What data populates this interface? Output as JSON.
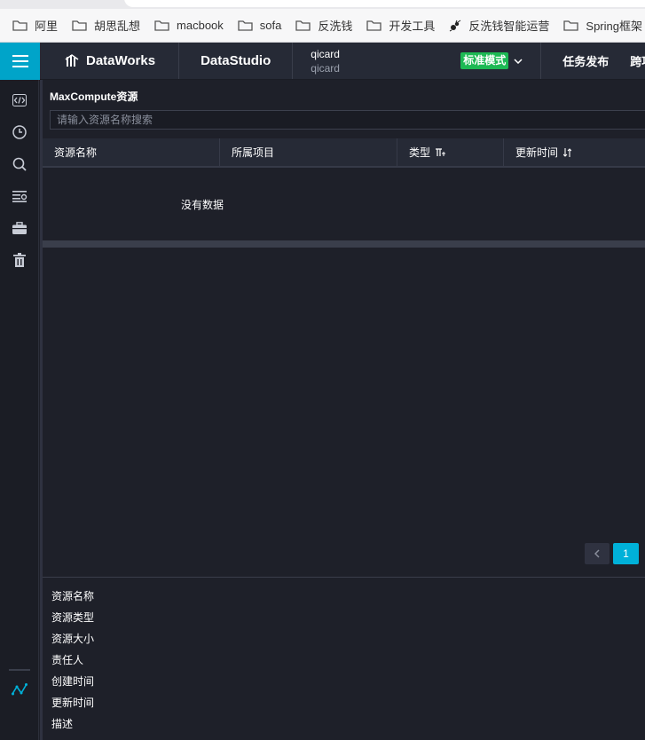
{
  "bookmarks": [
    {
      "label": "阿里",
      "icon": "folder-icon"
    },
    {
      "label": "胡思乱想",
      "icon": "folder-icon"
    },
    {
      "label": "macbook",
      "icon": "folder-icon"
    },
    {
      "label": "sofa",
      "icon": "folder-icon"
    },
    {
      "label": "反洗钱",
      "icon": "folder-icon"
    },
    {
      "label": "开发工具",
      "icon": "folder-icon"
    },
    {
      "label": "反洗钱智能运营",
      "icon": "ant-icon"
    },
    {
      "label": "Spring框架",
      "icon": "folder-icon"
    }
  ],
  "topnav": {
    "brand": "DataWorks",
    "studio": "DataStudio",
    "project_name": "qicard",
    "project_sub": "qicard",
    "mode_badge": "标准模式",
    "links": [
      "任务发布",
      "跨项目"
    ],
    "accent": "#00a4c9",
    "mode_color": "#1db954"
  },
  "sidebar": {
    "icons": [
      "code-icon",
      "history-icon",
      "search-icon",
      "list-settings-icon",
      "toolbox-icon",
      "trash-icon",
      "lineage-icon"
    ]
  },
  "main": {
    "section_title": "MaxCompute资源",
    "search_placeholder": "请输入资源名称搜索",
    "columns": [
      "资源名称",
      "所属项目",
      "类型",
      "更新时间"
    ],
    "empty_text": "没有数据",
    "page": "1",
    "details": [
      "资源名称",
      "资源类型",
      "资源大小",
      "责任人",
      "创建时间",
      "更新时间",
      "描述"
    ]
  }
}
